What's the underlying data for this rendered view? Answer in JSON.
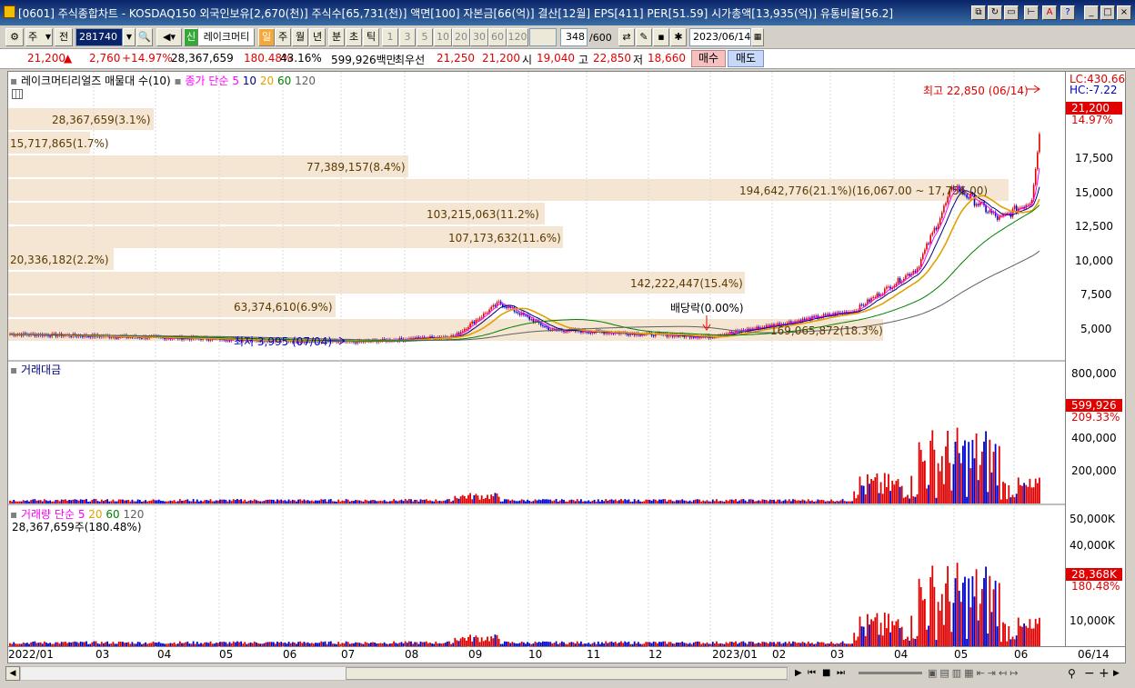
{
  "titlebar": {
    "title": "[0601] 주식종합차트 - KOSDAQ150 외국인보유[2,670(천)] 주식수[65,731(천)] 액면[100] 자본금[66(억)] 결산[12월] EPS[411] PER[51.59] 시가총액[13,935(억)] 유통비율[56.2]"
  },
  "toolbar": {
    "mode_select": "주",
    "prev_label": "전",
    "code_value": "281740",
    "stock_name": "레이크머티",
    "period_buttons": [
      "일",
      "주",
      "월",
      "년",
      "분",
      "초",
      "틱"
    ],
    "interval_buttons": [
      "1",
      "3",
      "5",
      "10",
      "20",
      "30",
      "60",
      "120"
    ],
    "count_value": "348",
    "count_total": "/600",
    "date_value": "2023/06/14"
  },
  "quote": {
    "price": "21,200",
    "change": "2,760",
    "change_pct": "+14.97%",
    "volume": "28,367,659",
    "volume_ratio": "180.48%",
    "turnover": "43.16%",
    "amount": "599,926백만",
    "best_ask_label": "최우선",
    "best_ask": "21,250",
    "best_bid": "21,200",
    "open_label": "시",
    "open": "19,040",
    "high_label": "고",
    "high": "22,850",
    "low_label": "저",
    "low": "18,660",
    "buy_label": "매수",
    "sell_label": "매도"
  },
  "price_panel": {
    "legend_name": "레이크머티리얼즈 매물대 수(10)",
    "legend_ma": "종가 단순",
    "ma_periods": [
      "5",
      "10",
      "20",
      "60",
      "120"
    ],
    "lc": "LC:430.66",
    "hc": "HC:-7.22",
    "high_note": "최고 22,850 (06/14)",
    "low_note": "최저 3,995 (07/04)",
    "dividend_note": "배당락(0.00%)",
    "current_price": "21,200",
    "current_pct": "14.97%",
    "y_ticks": [
      "17,500",
      "15,000",
      "12,500",
      "10,000",
      "7,500",
      "5,000"
    ],
    "volume_profile": [
      {
        "label": "28,367,659(3.1%)"
      },
      {
        "label": "15,717,865(1.7%)"
      },
      {
        "label": "77,389,157(8.4%)"
      },
      {
        "label": "194,642,776(21.1%)(16,067.00 ~ 17,756.00)"
      },
      {
        "label": "103,215,063(11.2%)"
      },
      {
        "label": "107,173,632(11.6%)"
      },
      {
        "label": "20,336,182(2.2%)"
      },
      {
        "label": "142,222,447(15.4%)"
      },
      {
        "label": "63,374,610(6.9%)"
      },
      {
        "label": "169,065,872(18.3%)"
      }
    ]
  },
  "amount_panel": {
    "legend": "거래대금",
    "current": "599,926",
    "current_pct": "209.33%",
    "y_ticks": [
      "800,000",
      "600,000",
      "400,000",
      "200,000"
    ]
  },
  "volume_panel": {
    "legend": "거래량 단순",
    "ma_periods": [
      "5",
      "20",
      "60",
      "120"
    ],
    "current_line": "28,367,659주(180.48%)",
    "current": "28,368K",
    "current_pct": "180.48%",
    "y_ticks": [
      "50,000K",
      "40,000K",
      "30,000K",
      "20,000K",
      "10,000K"
    ]
  },
  "x_axis": {
    "labels": [
      "2022/01",
      "03",
      "04",
      "05",
      "06",
      "07",
      "08",
      "09",
      "10",
      "11",
      "12",
      "2023/01",
      "02",
      "03",
      "04",
      "05",
      "06"
    ],
    "current_date": "06/14"
  },
  "colors": {
    "up": "#e00000",
    "down": "#0000cc",
    "ma5": "#ff00ff",
    "ma10": "#000080",
    "ma20": "#e0a000",
    "ma60": "#008000",
    "ma120": "#606060",
    "profile": "#f5e6d3"
  }
}
